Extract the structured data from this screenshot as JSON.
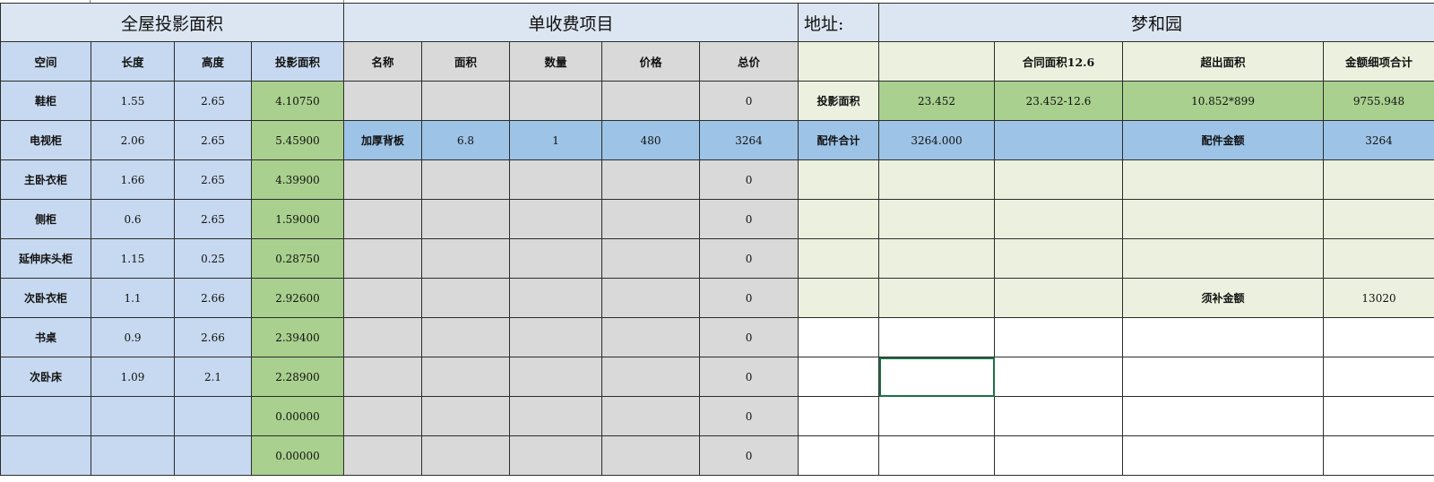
{
  "sections": {
    "projection": "全屋投影面积",
    "single_charge": "单收费项目",
    "address_label": "地址:",
    "address_value": "梦和园"
  },
  "headers": {
    "left": [
      "空间",
      "长度",
      "高度",
      "投影面积"
    ],
    "middle": [
      "名称",
      "面积",
      "数量",
      "价格",
      "总价"
    ],
    "right": [
      "",
      "",
      "合同面积12.6",
      "超出面积",
      "金额细项合计"
    ]
  },
  "rows": [
    {
      "space": "鞋柜",
      "length": "1.55",
      "height": "2.65",
      "area": "4.10750",
      "name": "",
      "m_area": "",
      "qty": "",
      "price": "",
      "total": "0",
      "r1": "投影面积",
      "r2": "23.452",
      "r3": "23.452-12.6",
      "r4": "10.852*899",
      "r5": "9755.948"
    },
    {
      "space": "电视柜",
      "length": "2.06",
      "height": "2.65",
      "area": "5.45900",
      "name": "加厚背板",
      "m_area": "6.8",
      "qty": "1",
      "price": "480",
      "total": "3264",
      "r1": "配件合计",
      "r2": "3264.000",
      "r3": "",
      "r4": "配件金额",
      "r5": "3264"
    },
    {
      "space": "主卧衣柜",
      "length": "1.66",
      "height": "2.65",
      "area": "4.39900",
      "name": "",
      "m_area": "",
      "qty": "",
      "price": "",
      "total": "0",
      "r1": "",
      "r2": "",
      "r3": "",
      "r4": "",
      "r5": ""
    },
    {
      "space": "侧柜",
      "length": "0.6",
      "height": "2.65",
      "area": "1.59000",
      "name": "",
      "m_area": "",
      "qty": "",
      "price": "",
      "total": "0",
      "r1": "",
      "r2": "",
      "r3": "",
      "r4": "",
      "r5": ""
    },
    {
      "space": "延伸床头柜",
      "length": "1.15",
      "height": "0.25",
      "area": "0.28750",
      "name": "",
      "m_area": "",
      "qty": "",
      "price": "",
      "total": "0",
      "r1": "",
      "r2": "",
      "r3": "",
      "r4": "",
      "r5": ""
    },
    {
      "space": "次卧衣柜",
      "length": "1.1",
      "height": "2.66",
      "area": "2.92600",
      "name": "",
      "m_area": "",
      "qty": "",
      "price": "",
      "total": "0",
      "r1": "",
      "r2": "",
      "r3": "",
      "r4": "须补金额",
      "r5": "13020"
    },
    {
      "space": "书桌",
      "length": "0.9",
      "height": "2.66",
      "area": "2.39400",
      "name": "",
      "m_area": "",
      "qty": "",
      "price": "",
      "total": "0",
      "r1": "",
      "r2": "",
      "r3": "",
      "r4": "",
      "r5": ""
    },
    {
      "space": "次卧床",
      "length": "1.09",
      "height": "2.1",
      "area": "2.28900",
      "name": "",
      "m_area": "",
      "qty": "",
      "price": "",
      "total": "0",
      "r1": "",
      "r2": "",
      "r3": "",
      "r4": "",
      "r5": ""
    },
    {
      "space": "",
      "length": "",
      "height": "",
      "area": "0.00000",
      "name": "",
      "m_area": "",
      "qty": "",
      "price": "",
      "total": "0",
      "r1": "",
      "r2": "",
      "r3": "",
      "r4": "",
      "r5": ""
    },
    {
      "space": "",
      "length": "",
      "height": "",
      "area": "0.00000",
      "name": "",
      "m_area": "",
      "qty": "",
      "price": "",
      "total": "0",
      "r1": "",
      "r2": "",
      "r3": "",
      "r4": "",
      "r5": ""
    }
  ],
  "colors": {
    "blue": "#c7d9f0",
    "green": "#a9d08e",
    "grey": "#d9d9d9",
    "mid_blue": "#9dc3e6",
    "pale_green": "#ebf1de",
    "title": "#dce6f2",
    "selection": "#1e7145"
  }
}
